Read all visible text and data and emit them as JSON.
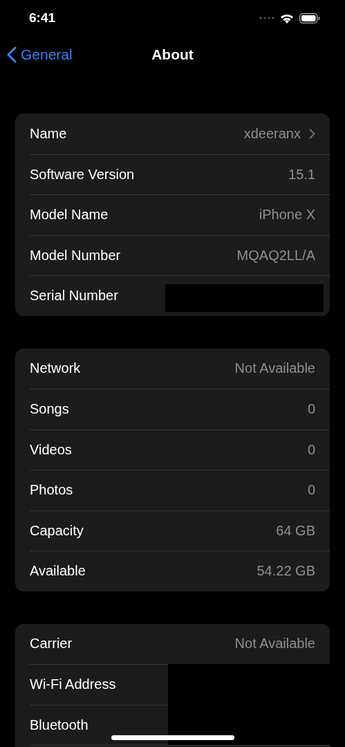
{
  "status_bar": {
    "time": "6:41"
  },
  "nav": {
    "back": "General",
    "title": "About"
  },
  "groups": [
    {
      "rows": [
        {
          "label": "Name",
          "value": "xdeeranx",
          "kind": "link"
        },
        {
          "label": "Software Version",
          "value": "15.1",
          "kind": "value"
        },
        {
          "label": "Model Name",
          "value": "iPhone X",
          "kind": "value"
        },
        {
          "label": "Model Number",
          "value": "MQAQ2LL/A",
          "kind": "value"
        },
        {
          "label": "Serial Number",
          "kind": "redacted"
        }
      ]
    },
    {
      "rows": [
        {
          "label": "Network",
          "value": "Not Available",
          "kind": "value"
        },
        {
          "label": "Songs",
          "value": "0",
          "kind": "value"
        },
        {
          "label": "Videos",
          "value": "0",
          "kind": "value"
        },
        {
          "label": "Photos",
          "value": "0",
          "kind": "value"
        },
        {
          "label": "Capacity",
          "value": "64 GB",
          "kind": "value"
        },
        {
          "label": "Available",
          "value": "54.22 GB",
          "kind": "value"
        }
      ]
    },
    {
      "rows": [
        {
          "label": "Carrier",
          "value": "Not Available",
          "kind": "value"
        },
        {
          "label": "Wi-Fi Address",
          "kind": "redacted-wide"
        },
        {
          "label": "Bluetooth",
          "kind": "redacted-wide"
        },
        {
          "kind": "hidden"
        }
      ]
    }
  ]
}
